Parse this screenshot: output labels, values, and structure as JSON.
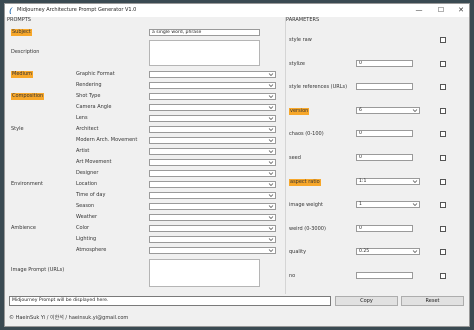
{
  "window": {
    "title": "Midjourney Architecture Prompt Generator V1.0",
    "minimize_glyph": "—",
    "maximize_glyph": "☐",
    "close_glyph": "✕"
  },
  "prompts": {
    "header": "PROMPTS",
    "subject_label": "Subject",
    "subject_value": "a single word, phrase",
    "description_label": "Description",
    "medium_label": "Medium",
    "composition_label": "Composition",
    "style_label": "Style",
    "environment_label": "Environment",
    "ambience_label": "Ambience",
    "image_prompt_label": "Image Prompt (URLs)",
    "rows": [
      {
        "label": "Graphic Format",
        "value": ""
      },
      {
        "label": "Rendering",
        "value": ""
      },
      {
        "label": "Shot Type",
        "value": ""
      },
      {
        "label": "Camera Angle",
        "value": ""
      },
      {
        "label": "Lens",
        "value": ""
      },
      {
        "label": "Architect",
        "value": ""
      },
      {
        "label": "Modern Arch. Movement",
        "value": ""
      },
      {
        "label": "Artist",
        "value": ""
      },
      {
        "label": "Art Movement",
        "value": ""
      },
      {
        "label": "Designer",
        "value": ""
      },
      {
        "label": "Location",
        "value": ""
      },
      {
        "label": "Time of day",
        "value": ""
      },
      {
        "label": "Season",
        "value": ""
      },
      {
        "label": "Weather",
        "value": ""
      },
      {
        "label": "Color",
        "value": ""
      },
      {
        "label": "Lighting",
        "value": ""
      },
      {
        "label": "Atmosphere",
        "value": ""
      }
    ]
  },
  "parameters": {
    "header": "PARAMETERS",
    "rows": [
      {
        "label": "style raw",
        "highlight": false,
        "control": "none",
        "value": "",
        "checked": false
      },
      {
        "label": "stylize",
        "highlight": false,
        "control": "input",
        "value": "0",
        "checked": false
      },
      {
        "label": "style references (URLs)",
        "highlight": false,
        "control": "input",
        "value": "",
        "checked": false
      },
      {
        "label": "version",
        "highlight": true,
        "control": "select",
        "value": "6",
        "checked": false
      },
      {
        "label": "chaos (0-100)",
        "highlight": false,
        "control": "input",
        "value": "0",
        "checked": false
      },
      {
        "label": "seed",
        "highlight": false,
        "control": "input",
        "value": "0",
        "checked": false
      },
      {
        "label": "aspect ratio",
        "highlight": true,
        "control": "select",
        "value": "1:1",
        "checked": false
      },
      {
        "label": "image weight",
        "highlight": false,
        "control": "select",
        "value": "1",
        "checked": false
      },
      {
        "label": "weird (0-3000)",
        "highlight": false,
        "control": "input",
        "value": "0",
        "checked": false
      },
      {
        "label": "quality",
        "highlight": false,
        "control": "select",
        "value": "0.25",
        "checked": false
      },
      {
        "label": "no",
        "highlight": false,
        "control": "input",
        "value": "",
        "checked": false
      }
    ]
  },
  "footer": {
    "output_text": "Midjourney Prompt will be displayed here.",
    "copy_label": "Copy",
    "reset_label": "Reset",
    "credit": "© HaeinSuk Yi / 이한석 / haeinsuk.yi@gmail.com"
  },
  "colors": {
    "highlight": "#f7a72a",
    "window_bg": "#f0f0f0"
  }
}
